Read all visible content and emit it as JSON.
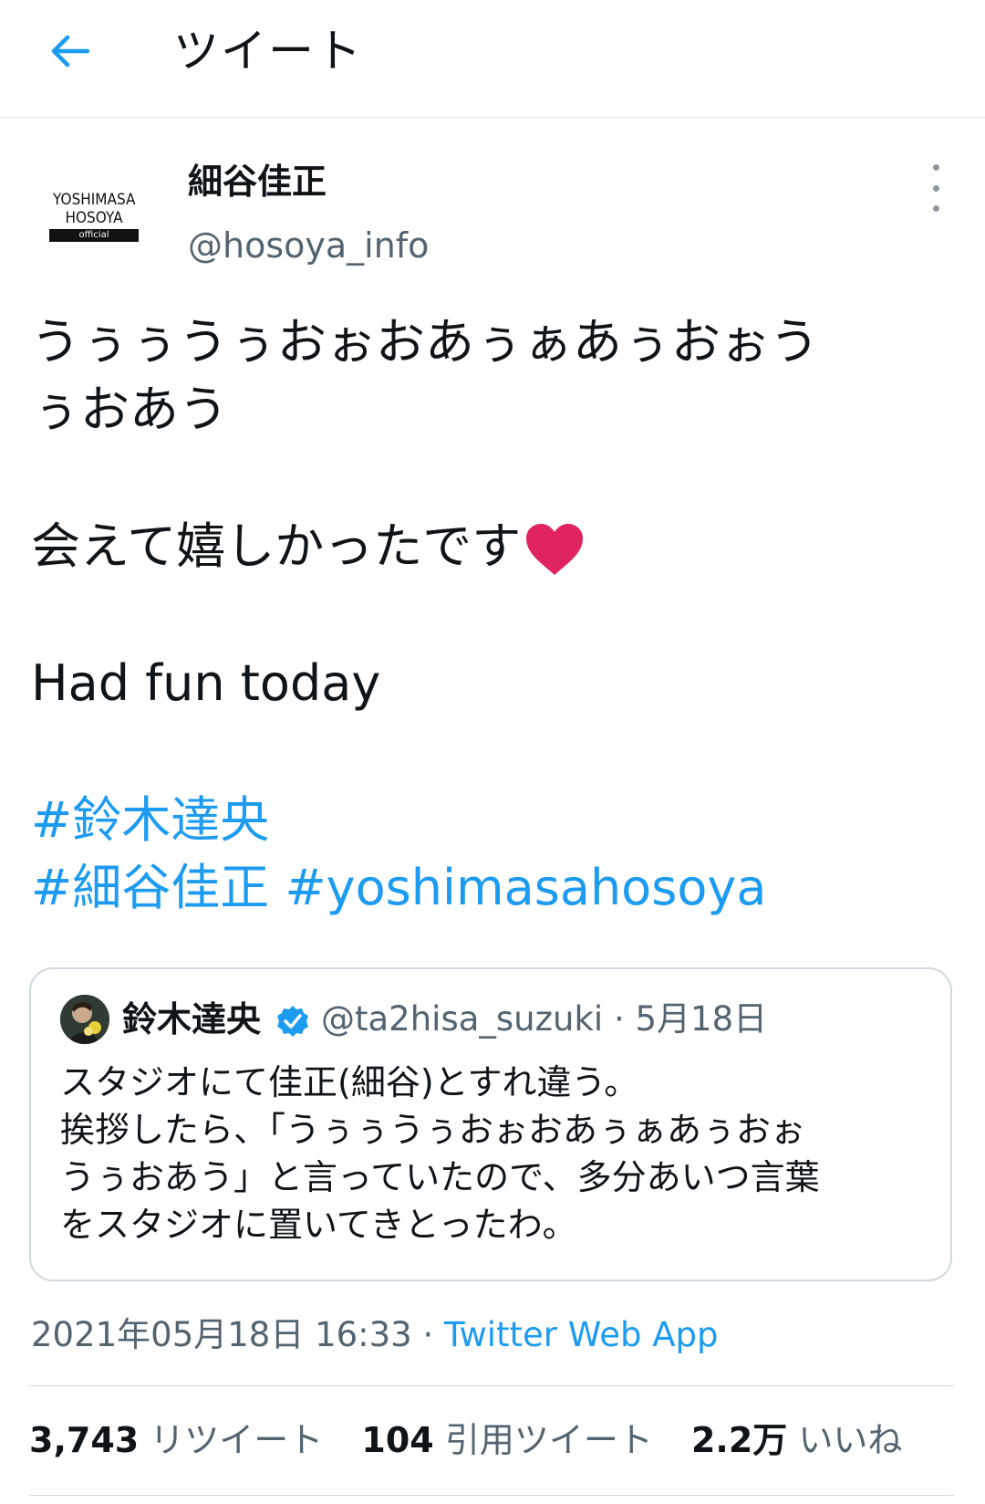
{
  "header": {
    "title": "ツイート"
  },
  "author": {
    "logo_line1": "YOSHIMASA",
    "logo_line2": "HOSOYA",
    "logo_tag": "official",
    "display_name": "細谷佳正",
    "handle": "@hosoya_info"
  },
  "tweet": {
    "line1": "うぅぅうぅおぉおあぅぁあぅおぉう",
    "line2": "ぅおあう",
    "line3": "会えて嬉しかったです",
    "line4": "Had fun today",
    "hashtag1": "#鈴木達央",
    "hashtag2": "#細谷佳正",
    "hashtag3": "#yoshimasahosoya"
  },
  "quote": {
    "name": "鈴木達央",
    "handle": "@ta2hisa_suzuki",
    "separator": "·",
    "date": "5月18日",
    "text1": "スタジオにて佳正(細谷)とすれ違う。",
    "text2": "挨拶したら、「うぅぅうぅおぉおあぅぁあぅおぉ",
    "text3": "うぅおあう」と言っていたので、多分あいつ言葉",
    "text4": "をスタジオに置いてきとったわ。"
  },
  "meta": {
    "timestamp": "2021年05月18日 16:33",
    "separator": " · ",
    "source": "Twitter Web App"
  },
  "stats": {
    "retweets_count": "3,743",
    "retweets_label": "リツイート",
    "quotes_count": "104",
    "quotes_label": "引用ツイート",
    "likes_count": "2.2万",
    "likes_label": "いいね"
  },
  "colors": {
    "accent": "#1d9bf0",
    "secondary_text": "#536471",
    "heart": "#e0245e"
  }
}
